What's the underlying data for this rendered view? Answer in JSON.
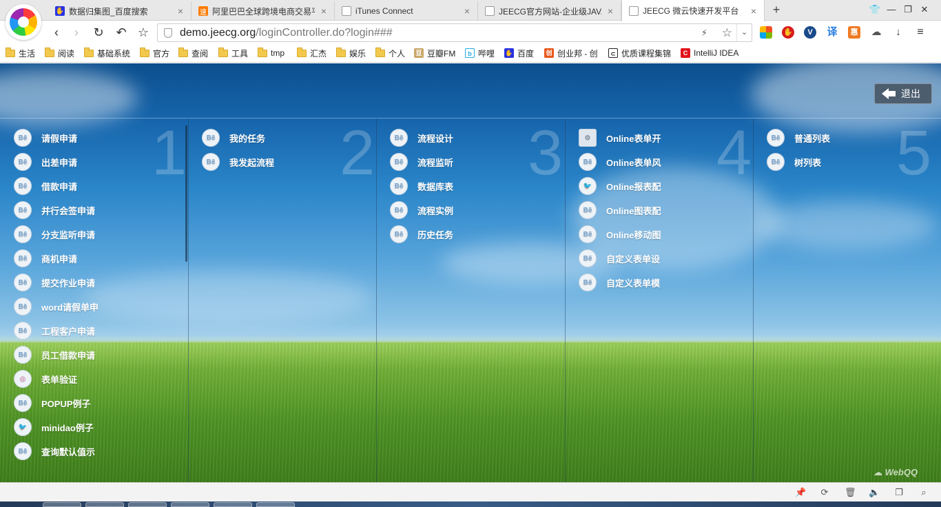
{
  "browser": {
    "tabs": [
      {
        "title": "数据归集图_百度搜索",
        "favicon": "baidu-paw-icon",
        "color": "#2932e1",
        "active": false
      },
      {
        "title": "阿里巴巴全球跨境电商交易平",
        "favicon": "aliexpress-icon",
        "color": "#ff7a00",
        "active": false
      },
      {
        "title": "iTunes Connect",
        "favicon": "page-icon",
        "color": "#888888",
        "active": false
      },
      {
        "title": "JEECG官方网站-企业级JAVA",
        "favicon": "page-icon",
        "color": "#888888",
        "active": false
      },
      {
        "title": "JEECG 微云快速开发平台",
        "favicon": "page-icon",
        "color": "#888888",
        "active": true
      }
    ],
    "tab_close": "×",
    "new_tab": "+",
    "url": {
      "host": "demo.jeecg.org",
      "path": "/loginController.do?login###"
    },
    "bookmarks": [
      {
        "label": "生活",
        "icon": "folder-icon"
      },
      {
        "label": "阅读",
        "icon": "folder-icon"
      },
      {
        "label": "基础系统",
        "icon": "folder-icon"
      },
      {
        "label": "官方",
        "icon": "folder-icon"
      },
      {
        "label": "查阅",
        "icon": "folder-icon"
      },
      {
        "label": "工具",
        "icon": "folder-icon"
      },
      {
        "label": "tmp",
        "icon": "folder-icon"
      },
      {
        "label": "汇杰",
        "icon": "folder-icon"
      },
      {
        "label": "娱乐",
        "icon": "folder-icon"
      },
      {
        "label": "个人",
        "icon": "folder-icon"
      },
      {
        "label": "豆瓣FM",
        "icon": "douban-icon"
      },
      {
        "label": "哔哩",
        "icon": "bilibili-icon"
      },
      {
        "label": "百度",
        "icon": "baidu-paw-icon"
      },
      {
        "label": "创业邦 - 创",
        "icon": "cyzone-icon"
      },
      {
        "label": "优质课程集锦",
        "icon": "course-icon"
      },
      {
        "label": "IntelliJ IDEA",
        "icon": "idea-icon"
      }
    ]
  },
  "page": {
    "logout_label": "退出",
    "watermark": "WebQQ",
    "columns": [
      {
        "number": "1",
        "items": [
          "请假申请",
          "出差申请",
          "借款申请",
          "并行会签申请",
          "分支监听申请",
          "商机申请",
          "提交作业申请",
          "word请假单申",
          "工程客户申请",
          "员工借款申请",
          "表单验证",
          "POPUP例子",
          "minidao例子",
          "查询默认值示"
        ],
        "icons": [
          "behance",
          "behance",
          "behance",
          "behance",
          "behance",
          "behance",
          "behance",
          "behance",
          "behance",
          "behance",
          "dribbble",
          "behance",
          "twitter",
          "behance"
        ]
      },
      {
        "number": "2",
        "items": [
          "我的任务",
          "我发起流程"
        ],
        "icons": [
          "behance",
          "behance"
        ]
      },
      {
        "number": "3",
        "items": [
          "流程设计",
          "流程监听",
          "数据库表",
          "流程实例",
          "历史任务"
        ],
        "icons": [
          "behance",
          "behance",
          "behance",
          "behance",
          "behance"
        ]
      },
      {
        "number": "4",
        "items": [
          "Online表单开",
          "Online表单风",
          "Online报表配",
          "Online图表配",
          "Online移动图",
          "自定义表单设",
          "自定义表单模"
        ],
        "icons": [
          "app",
          "behance",
          "twitter",
          "behance",
          "behance",
          "behance",
          "behance"
        ]
      },
      {
        "number": "5",
        "items": [
          "普通列表",
          "树列表"
        ],
        "icons": [
          "behance",
          "behance"
        ]
      }
    ]
  },
  "icon_glyph": "Bē"
}
